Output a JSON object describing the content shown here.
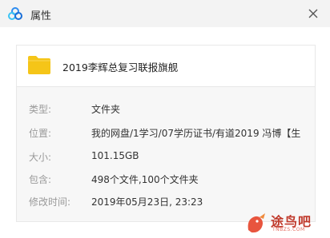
{
  "window": {
    "title": "属性",
    "app_icon": "baidu-netdisk-cloud-icon",
    "close_icon": "close-icon"
  },
  "file": {
    "icon": "folder-icon",
    "icon_color": "#f5c518",
    "name": "2019李辉总复习联报旗舰"
  },
  "properties": [
    {
      "label": "类型:",
      "value": "文件夹"
    },
    {
      "label": "位置:",
      "value": "我的网盘/1学习/07学历证书/有道2019 冯博【生"
    },
    {
      "label": "大小:",
      "value": "101.15GB"
    },
    {
      "label": "包含:",
      "value": "498个文件,100个文件夹"
    },
    {
      "label": "修改时间:",
      "value": "2019年05月23日, 23:23"
    }
  ],
  "watermark": {
    "text": "途鸟吧",
    "sub": "TNBZS.COM",
    "color": "#c0392b"
  }
}
